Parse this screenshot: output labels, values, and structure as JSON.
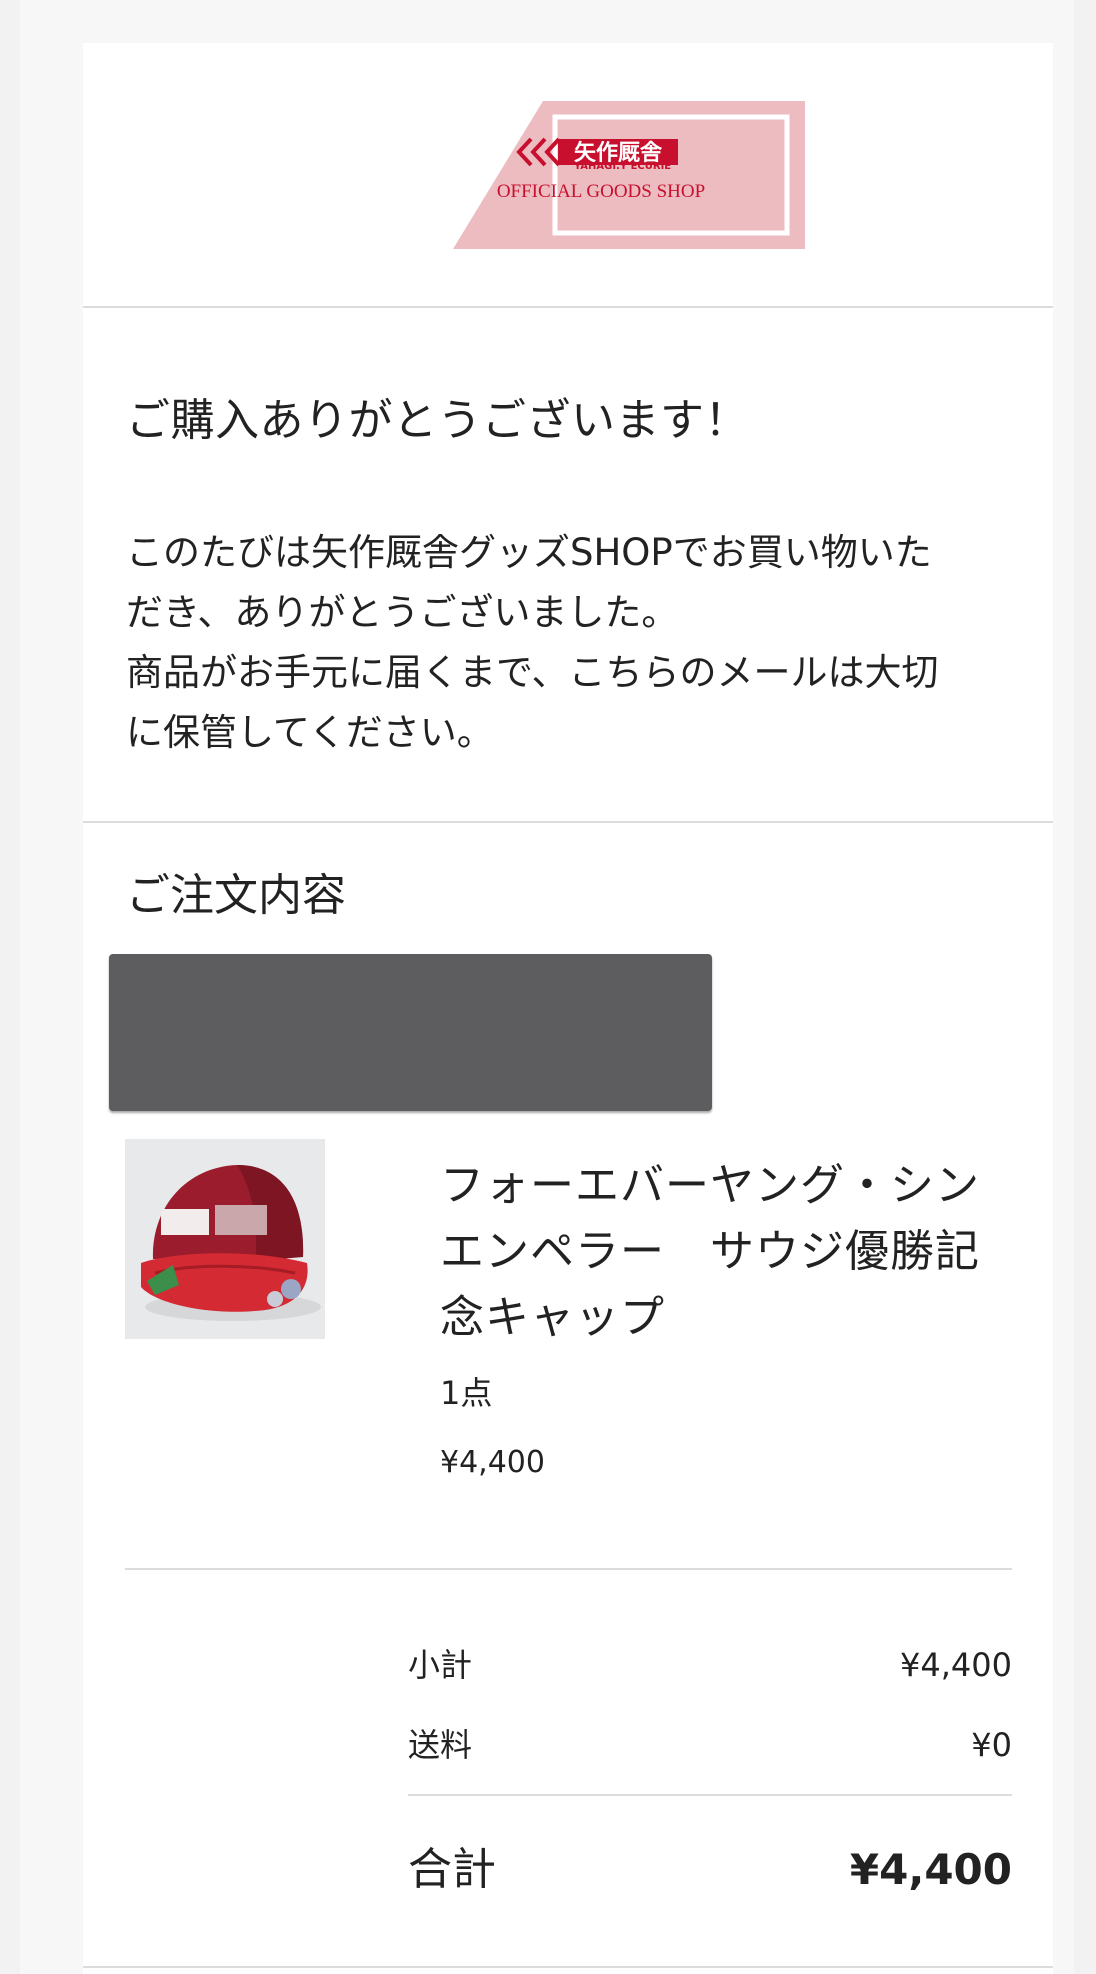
{
  "header": {
    "logo": {
      "brand_jp": "矢作厩舎",
      "brand_en": "YAHAGI.Y ECURIE",
      "shop_name": "OFFICIAL GOODS SHOP",
      "accent_color": "#c8102e",
      "panel_color": "#ecbcc1"
    }
  },
  "thanks": {
    "title": "ご購入ありがとうございます！",
    "body_lines": [
      "このたびは矢作厩舎グッズSHOPでお買い物いた",
      "だき、ありがとうございました。",
      "商品がお手元に届くまで、こちらのメールは大切",
      "に保管してください。"
    ]
  },
  "order": {
    "heading": "ご注文内容",
    "redacted_color": "#5d5d5f",
    "item": {
      "name_lines": [
        "フォーエバーヤング・シン",
        "エンペラー　サウジ優勝記",
        "念キャップ"
      ],
      "quantity": "1点",
      "price": "¥4,400",
      "thumbnail_icon": "red-cap-photo"
    },
    "summary": {
      "subtotal_label": "小計",
      "subtotal_value": "¥4,400",
      "shipping_label": "送料",
      "shipping_value": "¥0",
      "total_label": "合計",
      "total_value": "¥4,400"
    }
  }
}
